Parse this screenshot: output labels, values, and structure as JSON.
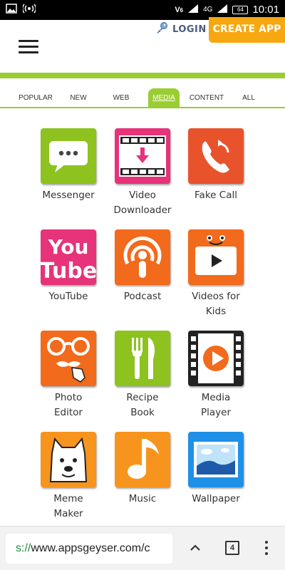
{
  "status_bar": {
    "time": "10:01",
    "battery": "64",
    "network": "4G"
  },
  "header": {
    "login_label": "LOGIN",
    "create_label": "CREATE APP"
  },
  "tabs": [
    {
      "label": "POPULAR",
      "active": false
    },
    {
      "label": "NEW",
      "active": false
    },
    {
      "label": "WEB",
      "active": false
    },
    {
      "label": "MEDIA",
      "active": true
    },
    {
      "label": "CONTENT",
      "active": false
    },
    {
      "label": "ALL",
      "active": false
    }
  ],
  "apps": [
    {
      "label": "Messenger",
      "icon": "chat-bubble-icon",
      "color": "#8dc21f"
    },
    {
      "label": "Video\nDownloader",
      "icon": "video-download-icon",
      "color": "#e6337a"
    },
    {
      "label": "Fake Call",
      "icon": "phone-icon",
      "color": "#e8532c"
    },
    {
      "label": "YouTube",
      "icon": "youtube-logo-icon",
      "color": "#e6337a"
    },
    {
      "label": "Podcast",
      "icon": "podcast-icon",
      "color": "#f26a1b"
    },
    {
      "label": "Videos for\nKids",
      "icon": "kids-video-icon",
      "color": "#f26a1b"
    },
    {
      "label": "Photo\nEditor",
      "icon": "glasses-mustache-icon",
      "color": "#f26a1b"
    },
    {
      "label": "Recipe\nBook",
      "icon": "fork-knife-icon",
      "color": "#8dc21f"
    },
    {
      "label": "Media\nPlayer",
      "icon": "film-play-icon",
      "color": "#222222"
    },
    {
      "label": "Meme\nMaker",
      "icon": "doge-icon",
      "color": "#f7941d"
    },
    {
      "label": "Music",
      "icon": "music-note-icon",
      "color": "#f7941d"
    },
    {
      "label": "Wallpaper",
      "icon": "landscape-picture-icon",
      "color": "#1e90e8"
    }
  ],
  "browser": {
    "url_scheme": "s://",
    "url_host": "www.appsgeyser.com/c",
    "tab_count": "4"
  },
  "colors": {
    "accent_green": "#9acd32",
    "create_orange": "#f7a70f"
  }
}
